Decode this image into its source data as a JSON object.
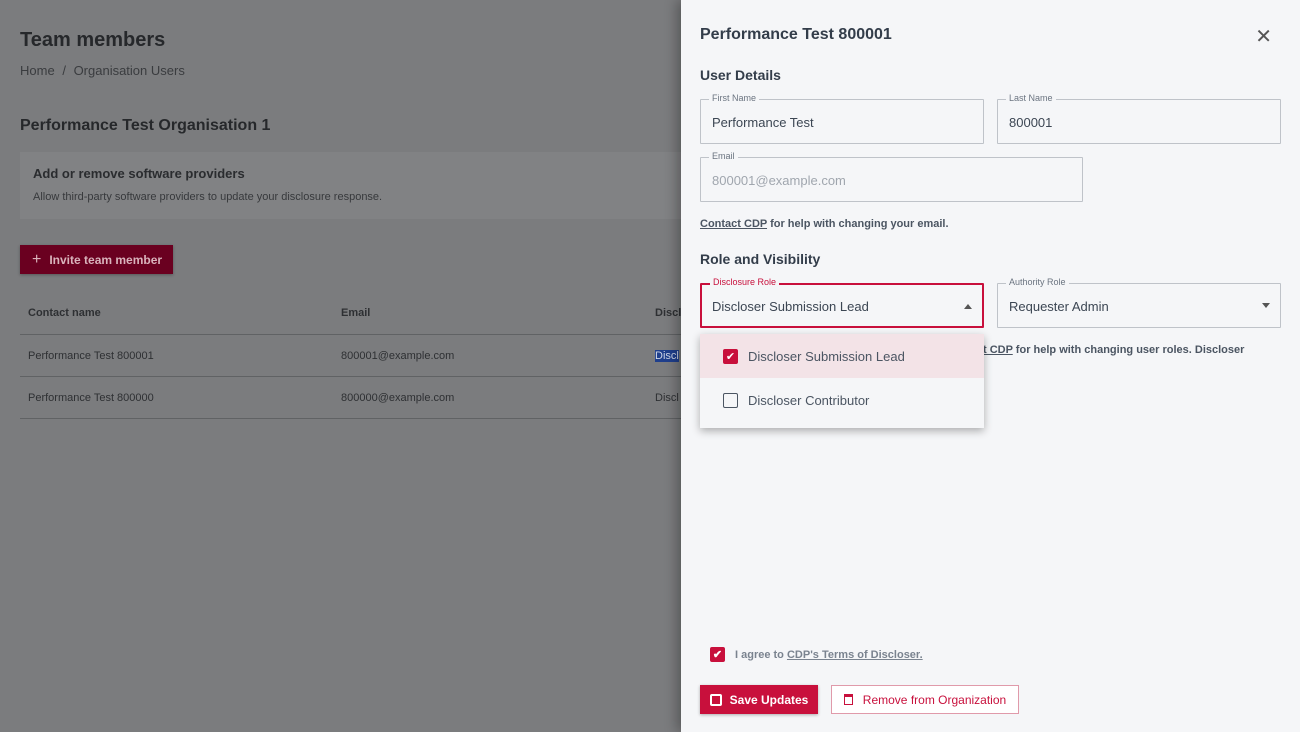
{
  "page": {
    "title": "Team members",
    "breadcrumb": [
      "Home",
      "/",
      "Organisation Users"
    ],
    "org_title": "Performance Test Organisation 1",
    "card": {
      "title": "Add or remove software providers",
      "subtitle": "Allow third-party software providers to update your disclosure response."
    },
    "invite_label": "Invite team member",
    "table": {
      "headers": [
        "Contact name",
        "Email",
        "Discl"
      ],
      "rows": [
        [
          "Performance Test 800001",
          "800001@example.com",
          "Discl"
        ],
        [
          "Performance Test 800000",
          "800000@example.com",
          "Discl"
        ]
      ]
    }
  },
  "panel": {
    "title": "Performance Test 800001",
    "user_details": "User Details",
    "first_name": {
      "label": "First Name",
      "value": "Performance Test"
    },
    "last_name": {
      "label": "Last Name",
      "value": "800001"
    },
    "email": {
      "label": "Email",
      "value": "800001@example.com"
    },
    "email_note_link": "Contact CDP",
    "email_note": " for help with changing your email.",
    "role_section": "Role and Visibility",
    "disclosure_role": {
      "label": "Disclosure Role",
      "value": "Discloser Submission Lead",
      "options": [
        {
          "label": "Discloser Submission Lead",
          "checked": true
        },
        {
          "label": "Discloser Contributor",
          "checked": false
        }
      ]
    },
    "authority_role": {
      "label": "Authority Role",
      "value": "Requester Admin"
    },
    "role_note_link": "t CDP",
    "role_note": " for help with changing user roles. Discloser",
    "agree_text": "I agree to ",
    "agree_link": "CDP's Terms of Discloser.",
    "save_label": "Save Updates",
    "remove_label": "Remove from Organization"
  },
  "colors": {
    "accent": "#c8103c"
  }
}
